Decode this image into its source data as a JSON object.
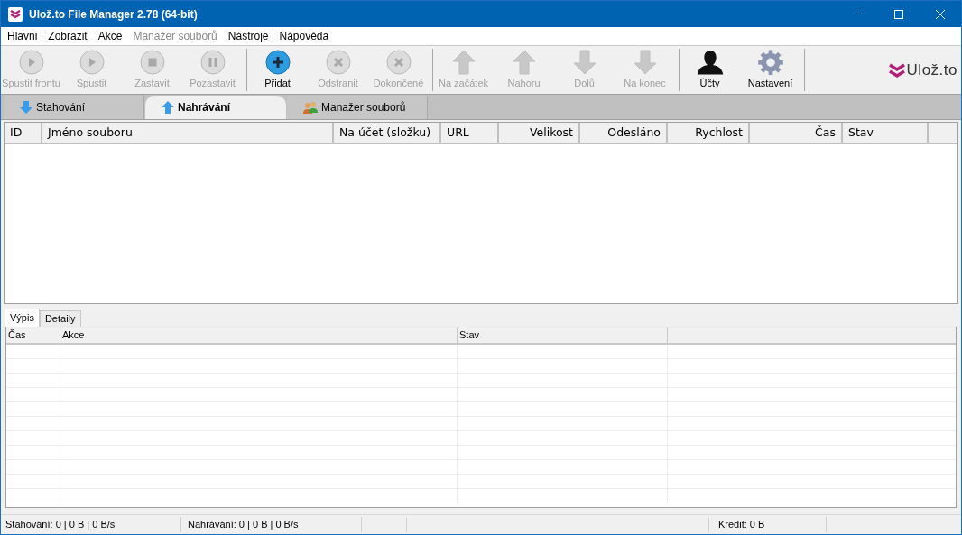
{
  "window": {
    "title": "Ulož.to File Manager 2.78 (64-bit)"
  },
  "menu": [
    {
      "label": "Hlavni",
      "disabled": false
    },
    {
      "label": "Zobrazit",
      "disabled": false
    },
    {
      "label": "Akce",
      "disabled": false
    },
    {
      "label": "Manažer souborů",
      "disabled": true
    },
    {
      "label": "Nástroje",
      "disabled": false
    },
    {
      "label": "Nápověda",
      "disabled": false
    }
  ],
  "toolbar": [
    {
      "group": [
        {
          "label": "Spustit frontu",
          "kind": "play",
          "disabled": true
        },
        {
          "label": "Spustit",
          "kind": "play",
          "disabled": true
        },
        {
          "label": "Zastavit",
          "kind": "stop",
          "disabled": true
        },
        {
          "label": "Pozastavit",
          "kind": "pause",
          "disabled": true
        }
      ]
    },
    {
      "group": [
        {
          "label": "Přidat",
          "kind": "add",
          "disabled": false
        },
        {
          "label": "Odstranit",
          "kind": "remove",
          "disabled": true
        },
        {
          "label": "Dokončené",
          "kind": "remove",
          "disabled": true
        }
      ]
    },
    {
      "group": [
        {
          "label": "Na začátek",
          "kind": "up",
          "disabled": true
        },
        {
          "label": "Nahoru",
          "kind": "up",
          "disabled": true
        },
        {
          "label": "Dolů",
          "kind": "down",
          "disabled": true
        },
        {
          "label": "Na konec",
          "kind": "down",
          "disabled": true
        }
      ]
    },
    {
      "group": [
        {
          "label": "Účty",
          "kind": "user",
          "disabled": false
        },
        {
          "label": "Nastavení",
          "kind": "gear",
          "disabled": false
        }
      ]
    }
  ],
  "logo": {
    "text": "Ulož.to"
  },
  "tabs": [
    {
      "label": "Stahování",
      "kind": "download",
      "selected": false
    },
    {
      "label": "Nahrávání",
      "kind": "upload",
      "selected": true
    },
    {
      "label": "Manažer souborů",
      "kind": "users",
      "selected": false
    }
  ],
  "table": {
    "columns": [
      "ID",
      "Jméno souboru",
      "Na účet (složku)",
      "URL",
      "Velikost",
      "Odesláno",
      "Rychlost",
      "Čas",
      "Stav"
    ]
  },
  "bottom_tabs": [
    {
      "label": "Výpis",
      "selected": true
    },
    {
      "label": "Detaily",
      "selected": false
    }
  ],
  "log": {
    "columns": [
      "Čas",
      "Akce",
      "Stav"
    ]
  },
  "status_bar": [
    "Stahování: 0 | 0 B | 0 B/s",
    "Nahrávání: 0 | 0 B | 0 B/s",
    "Kredit: 0 B"
  ]
}
